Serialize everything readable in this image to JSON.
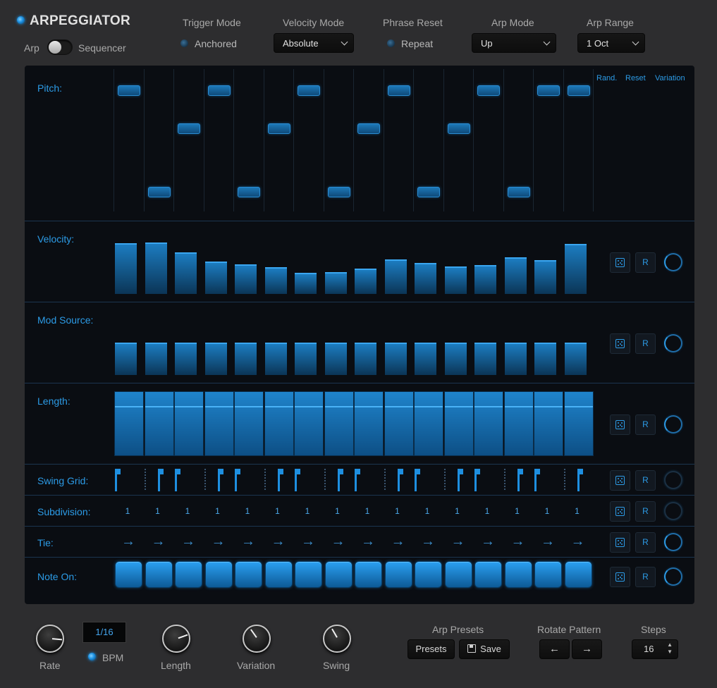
{
  "header": {
    "title": "ARPEGGIATOR",
    "mode_left": "Arp",
    "mode_right": "Sequencer",
    "trigger_mode": {
      "label": "Trigger Mode",
      "value": "Anchored"
    },
    "velocity_mode": {
      "label": "Velocity Mode",
      "value": "Absolute"
    },
    "phrase_reset": {
      "label": "Phrase Reset",
      "value": "Repeat"
    },
    "arp_mode": {
      "label": "Arp Mode",
      "value": "Up"
    },
    "arp_range": {
      "label": "Arp Range",
      "value": "1 Oct"
    }
  },
  "grid": {
    "links": {
      "rand": "Rand.",
      "reset": "Reset",
      "variation": "Variation"
    },
    "rows": {
      "pitch": "Pitch:",
      "velocity": "Velocity:",
      "mod_source": "Mod Source:",
      "length": "Length:",
      "swing_grid": "Swing Grid:",
      "subdivision": "Subdivision:",
      "tie": "Tie:",
      "note_on": "Note On:"
    },
    "reset_label": "R",
    "pitch_levels": [
      2,
      0,
      1,
      2,
      0,
      1,
      2,
      0,
      1,
      2,
      0,
      1,
      2,
      0,
      2,
      2
    ],
    "velocity_values": [
      0.72,
      0.73,
      0.59,
      0.46,
      0.42,
      0.38,
      0.3,
      0.31,
      0.36,
      0.49,
      0.44,
      0.39,
      0.41,
      0.52,
      0.48,
      0.71
    ],
    "mod_values": [
      0.46,
      0.46,
      0.46,
      0.46,
      0.46,
      0.46,
      0.46,
      0.46,
      0.46,
      0.46,
      0.46,
      0.46,
      0.46,
      0.46,
      0.46,
      0.46
    ],
    "length_values": [
      1,
      1,
      1,
      1,
      1,
      1,
      1,
      1,
      1,
      1,
      1,
      1,
      1,
      1,
      1,
      1
    ],
    "subdivision_values": [
      "1",
      "1",
      "1",
      "1",
      "1",
      "1",
      "1",
      "1",
      "1",
      "1",
      "1",
      "1",
      "1",
      "1",
      "1",
      "1"
    ],
    "tie_arrow": "→"
  },
  "footer": {
    "rate_label": "Rate",
    "rate_value": "1/16",
    "bpm_label": "BPM",
    "length_label": "Length",
    "variation_label": "Variation",
    "swing_label": "Swing",
    "arp_presets_label": "Arp Presets",
    "presets_button": "Presets",
    "save_button": "Save",
    "rotate_label": "Rotate Pattern",
    "rotate_left": "←",
    "rotate_right": "→",
    "steps_label": "Steps",
    "steps_value": "16"
  },
  "colors": {
    "accent": "#2c9be6",
    "panel": "#0a0d12",
    "background": "#2d2d2f"
  }
}
